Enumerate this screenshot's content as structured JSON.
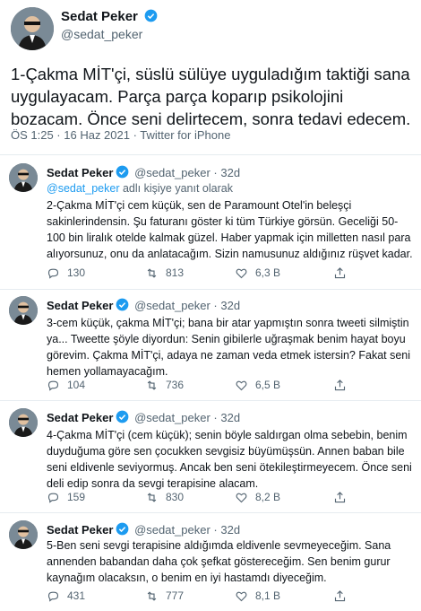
{
  "main_tweet": {
    "name": "Sedat Peker",
    "handle": "@sedat_peker",
    "text": "1-Çakma MİT'çi, süslü sülüye uyguladığım taktiği sana uygulayacam. Parça parça koparıp psikolojini bozacam. Önce seni delirtecem, sonra tedavi edecem.",
    "meta": "ÖS 1:25 · 16 Haz 2021 · Twitter for iPhone"
  },
  "replies": [
    {
      "name": "Sedat Peker",
      "handle": "@sedat_peker · 32d",
      "replying_handle": "@sedat_peker",
      "replying_suffix": " adlı kişiye yanıt olarak",
      "text": "2-Çakma MİT'çi cem küçük, sen de Paramount Otel'in beleşçi sakinlerindensin.  Şu faturanı göster ki tüm Türkiye görsün. Geceliği 50-100 bin liralık otelde kalmak güzel. Haber yapmak için milletten nasıl para alıyorsunuz, onu da anlatacağım. Sizin namusunuz aldığınız rüşvet kadar.",
      "replies_count": "130",
      "retweets": "813",
      "likes": "6,3 B"
    },
    {
      "name": "Sedat Peker",
      "handle": "@sedat_peker · 32d",
      "text": "3-cem küçük, çakma MİT'çi; bana bir atar yapmıştın sonra tweeti silmiştin ya... Tweette şöyle diyordun: Senin gibilerle uğraşmak benim hayat boyu görevim. Çakma MİT'çi, adaya ne zaman veda etmek istersin? Fakat seni hemen yollamayacağım.",
      "replies_count": "104",
      "retweets": "736",
      "likes": "6,5 B"
    },
    {
      "name": "Sedat Peker",
      "handle": "@sedat_peker · 32d",
      "text": "4-Çakma MİT'çi (cem küçük); senin böyle saldırgan olma sebebin, benim duyduğuma göre sen çocukken sevgisiz büyümüşsün. Annen baban bile seni eldivenle seviyormuş. Ancak ben seni ötekileştirmeyecem. Önce seni deli edip sonra da sevgi terapisine alacam.",
      "replies_count": "159",
      "retweets": "830",
      "likes": "8,2 B"
    },
    {
      "name": "Sedat Peker",
      "handle": "@sedat_peker · 32d",
      "text": "5-Ben seni sevgi terapisine aldığımda eldivenle sevmeyeceğim. Sana annenden babandan daha çok şefkat göstereceğim. Sen benim gurur kaynağım olacaksın, o benim en iyi hastamdı diyeceğim.",
      "replies_count": "431",
      "retweets": "777",
      "likes": "8,1 B"
    }
  ],
  "colors": {
    "accent": "#1d9bf0",
    "text": "#0f1419",
    "muted": "#536471",
    "divider": "#e6ecf0"
  },
  "icons": [
    "verified-badge-icon",
    "reply-icon",
    "retweet-icon",
    "like-icon",
    "share-icon"
  ]
}
